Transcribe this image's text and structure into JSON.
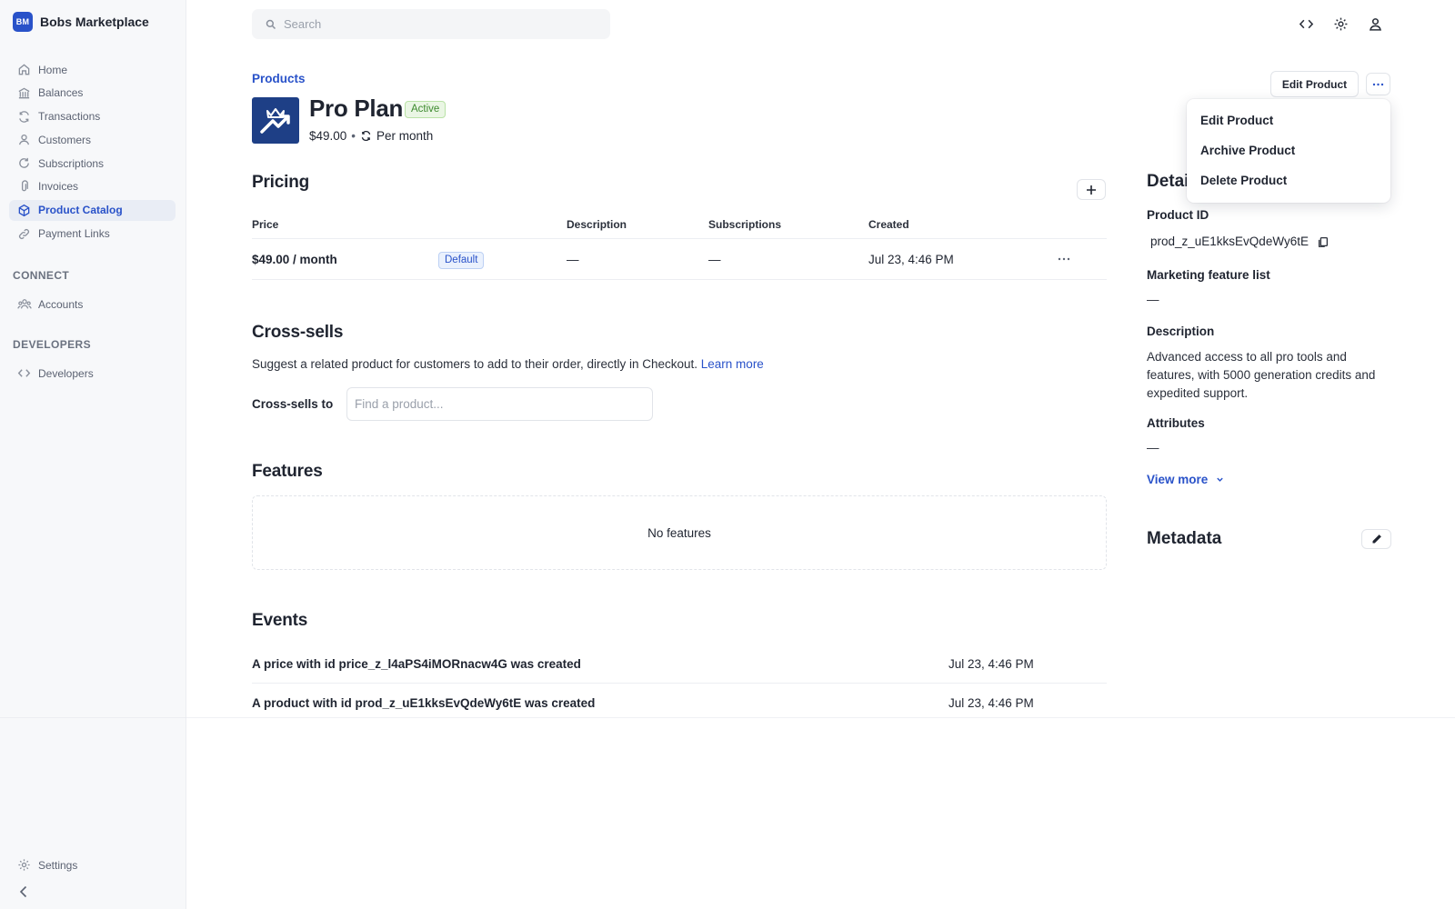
{
  "sidebar": {
    "brand_initials": "BM",
    "brand_name": "Bobs Marketplace",
    "items": [
      {
        "label": "Home",
        "icon": "home-icon"
      },
      {
        "label": "Balances",
        "icon": "bank-icon"
      },
      {
        "label": "Transactions",
        "icon": "arrows-cycle-icon"
      },
      {
        "label": "Customers",
        "icon": "person-icon"
      },
      {
        "label": "Subscriptions",
        "icon": "refresh-icon"
      },
      {
        "label": "Invoices",
        "icon": "paperclip-icon"
      },
      {
        "label": "Product Catalog",
        "icon": "cube-icon",
        "active": true
      },
      {
        "label": "Payment Links",
        "icon": "link-icon"
      }
    ],
    "connect_label": "CONNECT",
    "connect_items": [
      {
        "label": "Accounts",
        "icon": "people-icon"
      }
    ],
    "developers_label": "DEVELOPERS",
    "developers_items": [
      {
        "label": "Developers",
        "icon": "code-icon"
      }
    ],
    "settings_label": "Settings"
  },
  "topbar": {
    "search_placeholder": "Search",
    "icons": [
      "code-icon",
      "gear-icon",
      "user-icon"
    ]
  },
  "header": {
    "breadcrumb": "Products",
    "title": "Pro Plan",
    "status": "Active",
    "price": "$49.00",
    "separator": "•",
    "interval": "Per month",
    "edit_label": "Edit Product"
  },
  "menu": {
    "items": [
      "Edit Product",
      "Archive Product",
      "Delete Product"
    ]
  },
  "pricing": {
    "title": "Pricing",
    "columns": [
      "Price",
      "Description",
      "Subscriptions",
      "Created"
    ],
    "rows": [
      {
        "price": "$49.00 / month",
        "badge": "Default",
        "description": "—",
        "subscriptions": "—",
        "created": "Jul 23, 4:46 PM"
      }
    ]
  },
  "cross_sells": {
    "title": "Cross-sells",
    "description": "Suggest a related product for customers to add to their order, directly in Checkout.",
    "link": "Learn more",
    "label": "Cross-sells to",
    "placeholder": "Find a product..."
  },
  "features": {
    "title": "Features",
    "empty": "No features"
  },
  "events": {
    "title": "Events",
    "items": [
      {
        "text": "A price with id price_z_l4aPS4iMORnacw4G was created",
        "date": "Jul 23, 4:46 PM"
      },
      {
        "text": "A product with id prod_z_uE1kksEvQdeWy6tE was created",
        "date": "Jul 23, 4:46 PM"
      }
    ]
  },
  "details": {
    "title": "Details",
    "product_id_label": "Product ID",
    "product_id": "prod_z_uE1kksEvQdeWy6tE",
    "marketing_label": "Marketing feature list",
    "marketing_value": "—",
    "description_label": "Description",
    "description": "Advanced access to all pro tools and features, with 5000 generation credits and expedited support.",
    "attributes_label": "Attributes",
    "attributes_value": "—",
    "view_more": "View more"
  },
  "metadata": {
    "title": "Metadata"
  },
  "colors": {
    "accent": "#2952c9",
    "active_green": "#3d8a2e",
    "product_image_bg": "#1e3f86"
  }
}
